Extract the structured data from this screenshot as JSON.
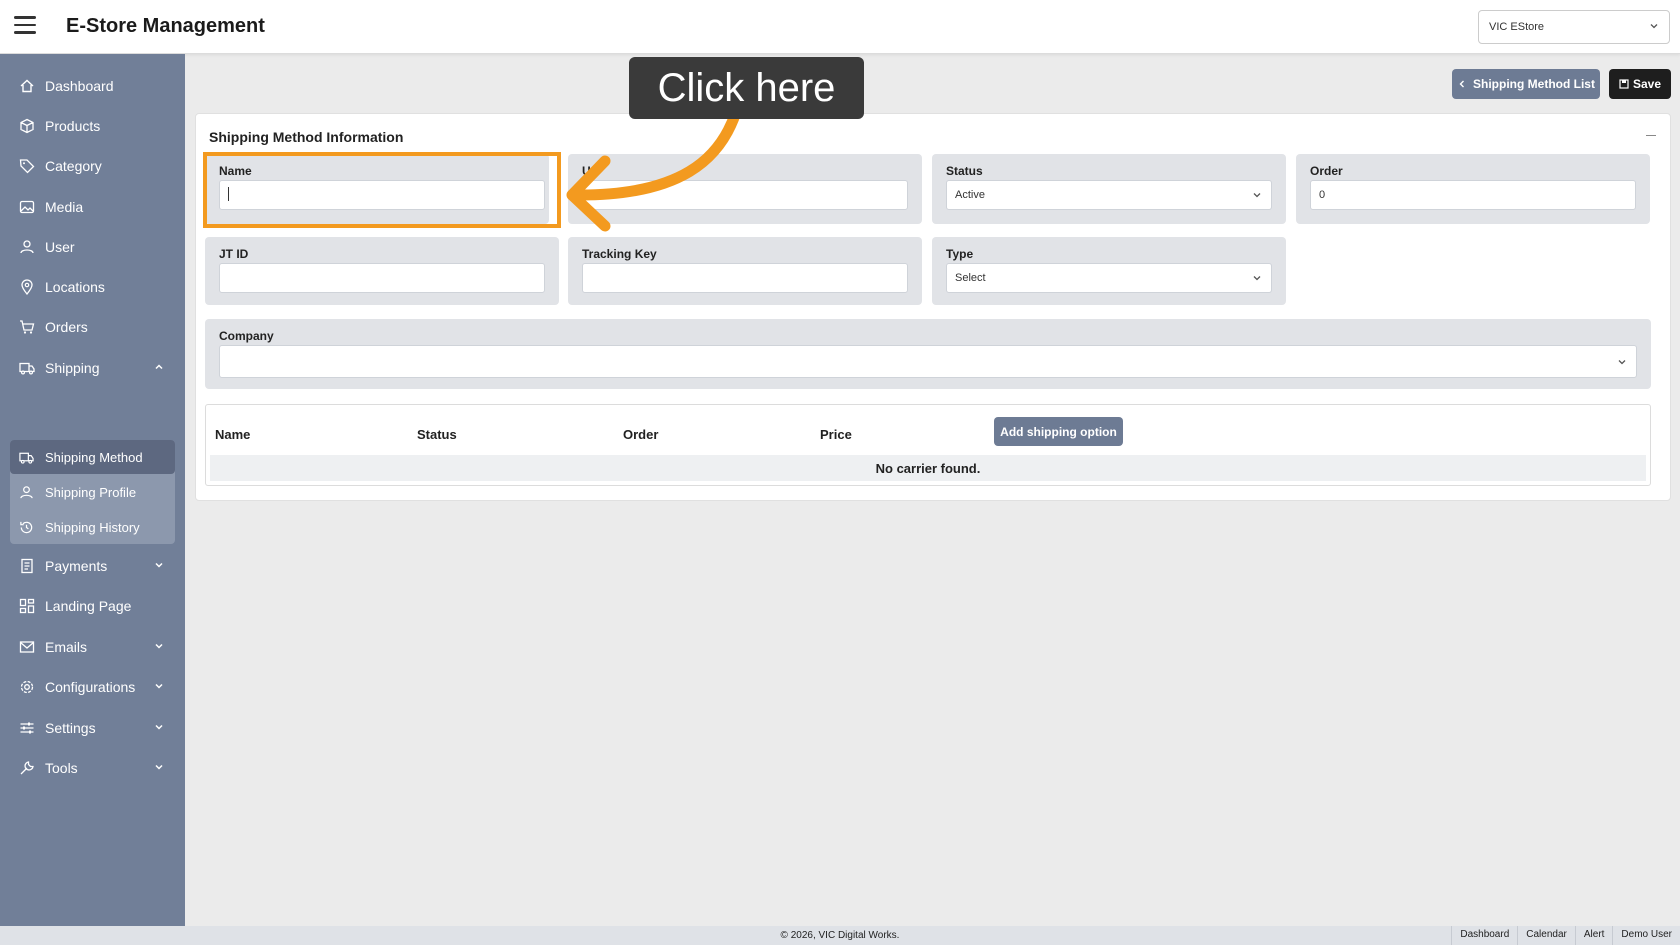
{
  "header": {
    "title": "E-Store Management",
    "store_selector": "VIC EStore"
  },
  "sidebar": {
    "items": [
      {
        "label": "Dashboard",
        "icon": "home-icon"
      },
      {
        "label": "Products",
        "icon": "box-icon"
      },
      {
        "label": "Category",
        "icon": "tag-icon"
      },
      {
        "label": "Media",
        "icon": "image-icon"
      },
      {
        "label": "User",
        "icon": "user-icon"
      },
      {
        "label": "Locations",
        "icon": "pin-icon"
      },
      {
        "label": "Orders",
        "icon": "cart-icon"
      },
      {
        "label": "Shipping",
        "icon": "truck-icon",
        "expanded": true
      },
      {
        "label": "Payments",
        "icon": "receipt-icon"
      },
      {
        "label": "Landing Page",
        "icon": "grid-icon"
      },
      {
        "label": "Emails",
        "icon": "mail-icon"
      },
      {
        "label": "Configurations",
        "icon": "gear-icon"
      },
      {
        "label": "Settings",
        "icon": "sliders-icon"
      },
      {
        "label": "Tools",
        "icon": "wrench-icon"
      }
    ],
    "shipping_sub": [
      {
        "label": "Shipping Method",
        "active": true
      },
      {
        "label": "Shipping Profile",
        "active": false
      },
      {
        "label": "Shipping History",
        "active": false
      }
    ]
  },
  "toolbar": {
    "list_label": "Shipping Method List",
    "save_label": "Save"
  },
  "form": {
    "title": "Shipping Method Information",
    "name_label": "Name",
    "name_value": "",
    "second_label_partial": "U",
    "status_label": "Status",
    "status_value": "Active",
    "order_label": "Order",
    "order_value": "0",
    "jtid_label": "JT ID",
    "tracking_label": "Tracking Key",
    "type_label": "Type",
    "type_value": "Select",
    "company_label": "Company"
  },
  "table": {
    "headers": [
      "Name",
      "Status",
      "Order",
      "Price"
    ],
    "add_label": "Add shipping option",
    "empty_text": "No carrier found."
  },
  "footer": {
    "copyright": "© 2026, VIC Digital Works.",
    "links": [
      "Dashboard",
      "Calendar",
      "Alert",
      "Demo User"
    ]
  },
  "annotation": {
    "tooltip": "Click here"
  },
  "colors": {
    "sidebar": "#717f98",
    "accent": "#6d7b94",
    "highlight": "#f39a1f"
  }
}
